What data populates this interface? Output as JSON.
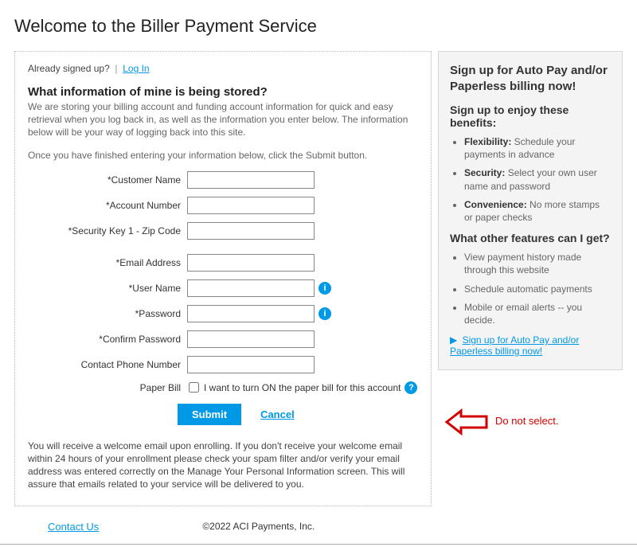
{
  "page": {
    "title": "Welcome to the Biller Payment Service"
  },
  "login": {
    "prompt": "Already signed up?",
    "separator": "|",
    "link_label": "Log In"
  },
  "info": {
    "heading": "What information of mine is being stored?",
    "body": "We are storing your billing account and funding account information for quick and easy retrieval when you log back in, as well as the information you enter below. The information below will be your way of logging back into this site.",
    "instruction": "Once you have finished entering your information below, click the Submit button."
  },
  "form": {
    "customer_name_label": "*Customer Name",
    "account_number_label": "*Account Number",
    "security_key_label": "*Security Key 1 - Zip Code",
    "email_label": "*Email Address",
    "username_label": "*User Name",
    "password_label": "*Password",
    "confirm_password_label": "*Confirm Password",
    "phone_label": "Contact Phone Number",
    "paperbill_label": "Paper Bill",
    "paperbill_text": "I want to turn ON the paper bill for this account",
    "submit_label": "Submit",
    "cancel_label": "Cancel",
    "info_glyph": "i",
    "help_glyph": "?"
  },
  "paperbill_checked": false,
  "disclaimer": "You will receive a welcome email upon enrolling. If you don't receive your welcome email within 24 hours of your enrollment please check your spam filter and/or verify your email address was entered correctly on the Manage Your Personal Information screen. This will assure that emails related to your service will be delivered to you.",
  "sidebar": {
    "heading": "Sign up for Auto Pay and/or Paperless billing now!",
    "benefits_heading": "Sign up to enjoy these benefits:",
    "benefits": [
      {
        "strong": "Flexibility:",
        "text": " Schedule your payments in advance"
      },
      {
        "strong": "Security:",
        "text": " Select your own user name and password"
      },
      {
        "strong": "Convenience:",
        "text": " No more stamps or paper checks"
      }
    ],
    "features_heading": "What other features can I get?",
    "features": [
      "View payment history made through this website",
      "Schedule automatic payments",
      "Mobile or email alerts -- you decide."
    ],
    "signup_arrow": "▶",
    "signup_link": "Sign up for Auto Pay and/or Paperless billing now!"
  },
  "footer": {
    "contact_label": "Contact Us",
    "copyright": "©2022 ACI Payments, Inc."
  },
  "annotation": {
    "text": "Do not select."
  }
}
